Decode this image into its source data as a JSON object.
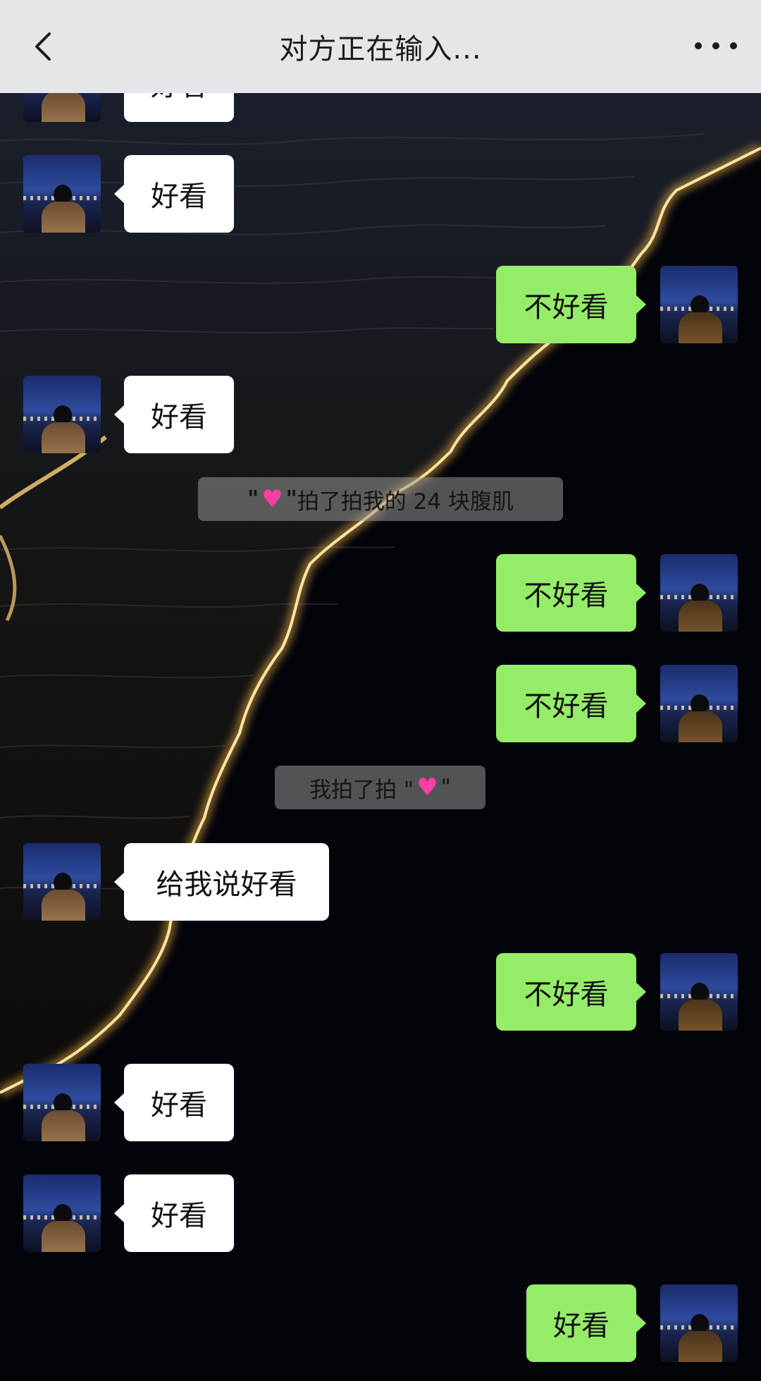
{
  "header": {
    "title": "对方正在输入..."
  },
  "colors": {
    "self_bubble": "#95ec69",
    "other_bubble": "#ffffff",
    "header_bg": "#e5e6e9",
    "heart": "#ff3fa4"
  },
  "messages": [
    {
      "side": "left",
      "text": "好看"
    },
    {
      "side": "left",
      "text": "好看"
    },
    {
      "side": "right",
      "text": "不好看"
    },
    {
      "side": "left",
      "text": "好看"
    },
    {
      "side": "system",
      "prefix": "\"",
      "icon": "heart",
      "middle": "\"",
      "suffix": " 拍了拍我的 24 块腹肌"
    },
    {
      "side": "right",
      "text": "不好看"
    },
    {
      "side": "right",
      "text": "不好看"
    },
    {
      "side": "system",
      "prefix": "我拍了拍 \"",
      "icon": "heart",
      "suffix": "\""
    },
    {
      "side": "left",
      "text": "给我说好看"
    },
    {
      "side": "right",
      "text": "不好看"
    },
    {
      "side": "left",
      "text": "好看"
    },
    {
      "side": "left",
      "text": "好看"
    },
    {
      "side": "right",
      "text": "好看"
    }
  ]
}
